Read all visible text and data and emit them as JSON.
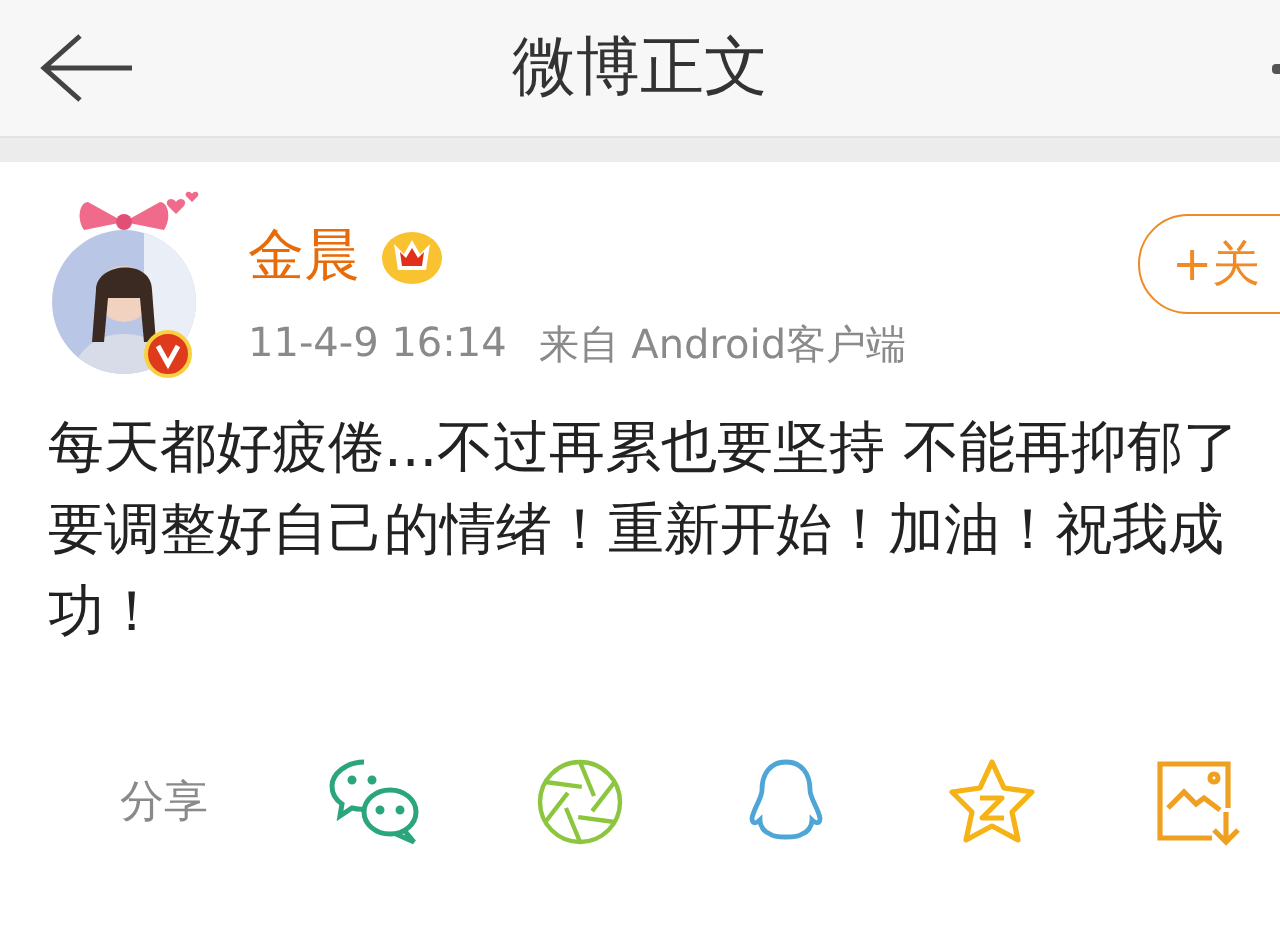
{
  "header": {
    "title": "微博正文"
  },
  "post": {
    "author": "金晨",
    "meta_time": "11-4-9 16:14",
    "meta_source": "来自 Android客户端",
    "follow_button": "+关",
    "verified": true,
    "text_lines": [
      "每天都好疲倦...不过再累也要坚持 不能再抑郁了",
      "要调整好自己的情绪！重新开始！加油！祝我成",
      "功！"
    ]
  },
  "share": {
    "label": "分享",
    "targets": [
      {
        "kind": "chat"
      },
      {
        "kind": "aperture"
      },
      {
        "kind": "penguin"
      },
      {
        "kind": "star"
      },
      {
        "kind": "save-image"
      }
    ]
  }
}
